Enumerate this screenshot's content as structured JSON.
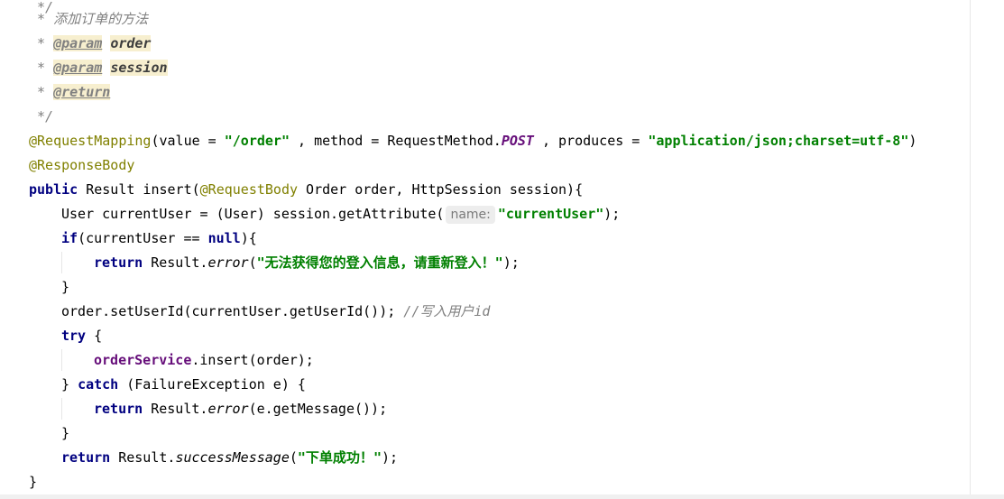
{
  "code": {
    "comment_desc": " * 添加订单的方法",
    "comment_star": " * ",
    "comment_end": " */",
    "param_tag": "@param",
    "return_tag": "@return",
    "param_order": "order",
    "param_session": "session",
    "request_mapping": "@RequestMapping",
    "mapping_open": "(value = ",
    "mapping_value": "\"/order\"",
    "mapping_method": " , method = RequestMethod.",
    "mapping_post": "POST",
    "mapping_produces": " , produces = ",
    "mapping_produces_value": "\"application/json;charset=utf-8\"",
    "close_paren": ")",
    "response_body": "@ResponseBody",
    "kw_public": "public",
    "sig_1": " Result insert(",
    "request_body": "@RequestBody",
    "sig_2": " Order order, HttpSession session){",
    "line_user_1": "User currentUser = (User) session.getAttribute(",
    "hint_name": "name:",
    "str_current_user": "\"currentUser\"",
    "close_semi": ");",
    "kw_if": "if",
    "if_cond_1": "(currentUser == ",
    "kw_null": "null",
    "if_cond_2": "){",
    "kw_return": "return",
    "result_dot": " Result.",
    "error_method": "error",
    "open_paren": "(",
    "str_login_again": "\"无法获得您的登入信息，请重新登入！\"",
    "close_brace": "}",
    "set_user": "order.setUserId(currentUser.getUserId()); ",
    "comment_write_uid": "//写入用户id",
    "kw_try": "try",
    "brace_open": " {",
    "order_service": "orderService",
    "insert_call": ".insert(order);",
    "brace_close_space": "} ",
    "kw_catch": "catch",
    "catch_rest": " (FailureException e) {",
    "get_message": "(e.getMessage());",
    "success_method": "successMessage",
    "str_success": "\"下单成功！\""
  }
}
